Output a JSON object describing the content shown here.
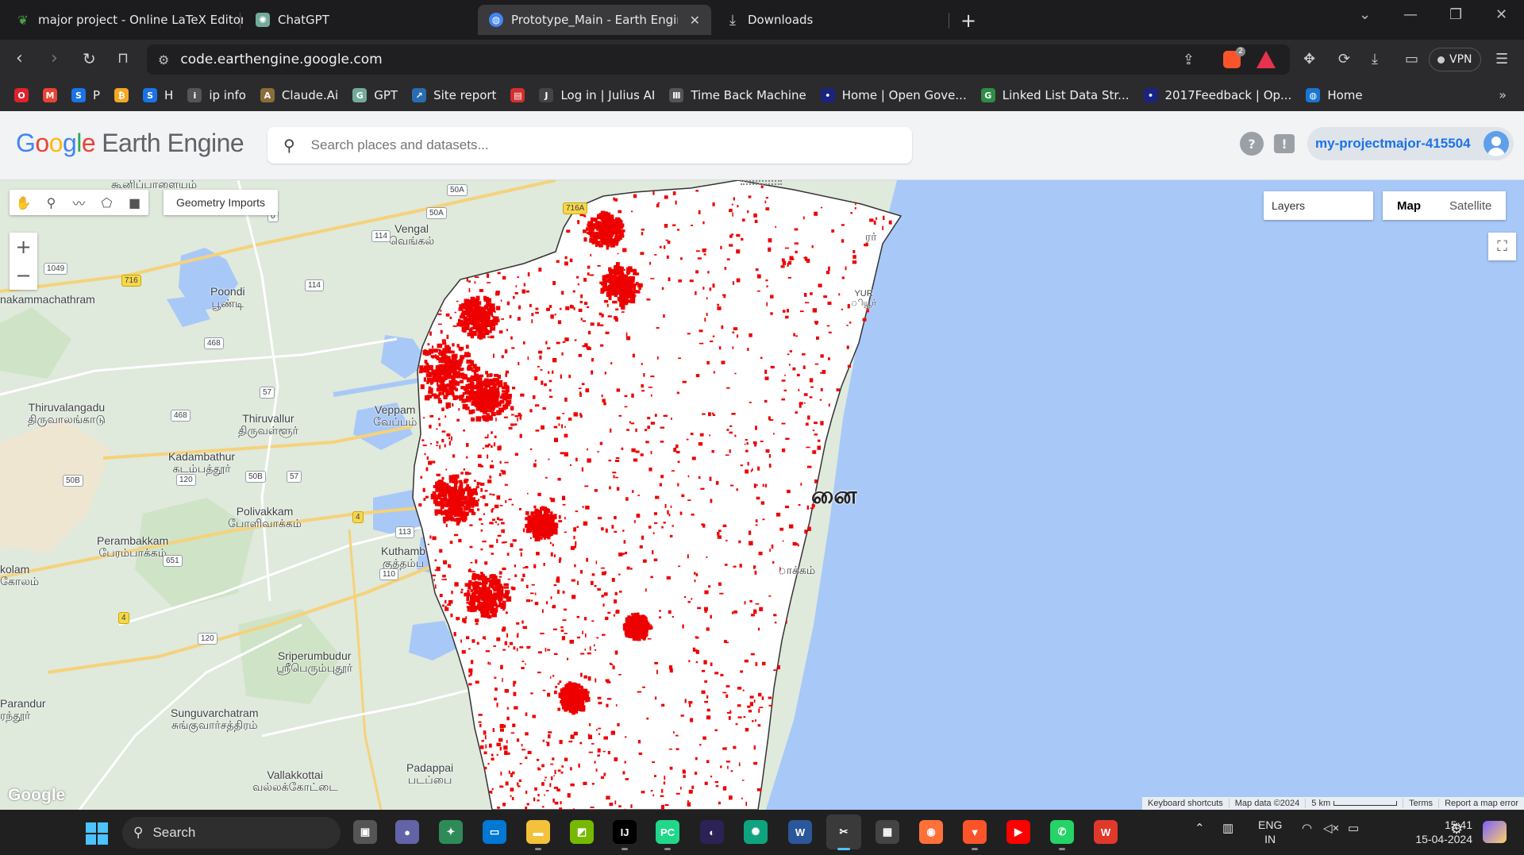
{
  "browser": {
    "tabs": [
      {
        "title": "major project - Online LaTeX Editor O",
        "icon": "overleaf-icon",
        "color": "#47a141"
      },
      {
        "title": "ChatGPT",
        "icon": "chatgpt-icon",
        "color": "#74aa9c"
      },
      {
        "title": "Prototype_Main - Earth Engine C",
        "icon": "earth-engine-icon",
        "color": "#4285f4",
        "active": true
      },
      {
        "title": "Downloads",
        "icon": "download-icon",
        "color": "#888888"
      }
    ],
    "new_tab_label": "+",
    "url": "code.earthengine.google.com",
    "vpn_label": "VPN",
    "brave_badge": "2"
  },
  "bookmarks": [
    {
      "label": "",
      "icon": "opera-icon",
      "color": "#e0212b",
      "glyph": "O"
    },
    {
      "label": "",
      "icon": "gmail-icon",
      "color": "#ea4335",
      "glyph": "M"
    },
    {
      "label": "P",
      "icon": "s-icon",
      "color": "#1a73e8",
      "glyph": "S"
    },
    {
      "label": "",
      "icon": "bolt-icon",
      "color": "#f5a623",
      "glyph": "₿"
    },
    {
      "label": "H",
      "icon": "s-icon",
      "color": "#1a73e8",
      "glyph": "S"
    },
    {
      "label": "ip info",
      "icon": "ipinfo-icon",
      "color": "#555555",
      "glyph": "i"
    },
    {
      "label": "Claude.Ai",
      "icon": "claude-icon",
      "color": "#8a6d3b",
      "glyph": "A"
    },
    {
      "label": "GPT",
      "icon": "chatgpt-icon",
      "color": "#74aa9c",
      "glyph": "G"
    },
    {
      "label": "Site report",
      "icon": "site-report-icon",
      "color": "#2b6cb0",
      "glyph": "↗"
    },
    {
      "label": "",
      "icon": "calendar-icon",
      "color": "#d32f2f",
      "glyph": "▤"
    },
    {
      "label": "Log in | Julius AI",
      "icon": "julius-icon",
      "color": "#444444",
      "glyph": "J"
    },
    {
      "label": "Time Back Machine",
      "icon": "archive-icon",
      "color": "#555555",
      "glyph": "Ⅲ"
    },
    {
      "label": "Home | Open Gove...",
      "icon": "ogd-icon",
      "color": "#1a237e",
      "glyph": "•"
    },
    {
      "label": "Linked List Data Str...",
      "icon": "gfg-icon",
      "color": "#2f8d46",
      "glyph": "G"
    },
    {
      "label": "2017Feedback | Op...",
      "icon": "ogd-icon",
      "color": "#1a237e",
      "glyph": "•"
    },
    {
      "label": "Home",
      "icon": "globe-icon",
      "color": "#1976d2",
      "glyph": "◍"
    }
  ],
  "ee": {
    "logo_google": [
      "G",
      "o",
      "o",
      "g",
      "l",
      "e"
    ],
    "logo_product": "Earth Engine",
    "search_placeholder": "Search places and datasets...",
    "help_label": "?",
    "feedback_label": "!",
    "project": "my-projectmajor-415504"
  },
  "map": {
    "geometry_imports_label": "Geometry Imports",
    "zoom_in": "+",
    "zoom_out": "−",
    "layers_label": "Layers",
    "map_type_options": [
      "Map",
      "Satellite"
    ],
    "selected_map_type": "Map",
    "google_logo": "Google",
    "attribution": {
      "keyboard": "Keyboard shortcuts",
      "data": "Map data ©2024",
      "scale": "5 km",
      "terms": "Terms",
      "report": "Report a map error"
    },
    "colors": {
      "land": "#dfe9dc",
      "water": "#a8c8f8",
      "overlay": "#ee0000",
      "roads": "#f5d27a"
    },
    "places": [
      {
        "text": "கூனிப்பாளையம்"
      },
      {
        "text": "Vengal\nவெங்கல்"
      },
      {
        "text": "Poondi\nபூண்டி"
      },
      {
        "text": "nakammachathram"
      },
      {
        "text": "Thiruvalangadu\nதிருவாலங்காடு"
      },
      {
        "text": "Thiruvallur\nதிருவள்ளூர்"
      },
      {
        "text": "Veppam\nவேப்பம்"
      },
      {
        "text": "Kadambathur\nகடம்பத்தூர்"
      },
      {
        "text": "Polivakkam\nபோளிவாக்கம்"
      },
      {
        "text": "Perambakkam\nபேரம்பாக்கம்"
      },
      {
        "text": "kolam\nகோலம்"
      },
      {
        "text": "Kuthamb\nகுத்தம்ப"
      },
      {
        "text": "Sriperumbudur\nஸ்ரீபெரும்புதூர்"
      },
      {
        "text": "Parandur\nரந்தூர்"
      },
      {
        "text": "Sunguvarchatram\nசுங்குவார்சத்திரம்"
      },
      {
        "text": "Vallakkottai\nவல்லக்கோட்டை"
      },
      {
        "text": "Padappai\nபடப்பை"
      },
      {
        "text": "னை"
      },
      {
        "text": "ாக்கம்"
      },
      {
        "text": "ரர்"
      },
      {
        "text": "YUR\nியூர்"
      }
    ],
    "shields": [
      "50A",
      "50A",
      "716A",
      "114",
      "114",
      "1049",
      "716",
      "468",
      "468",
      "57",
      "120",
      "50B",
      "50B",
      "57",
      "4",
      "113",
      "651",
      "110",
      "4",
      "120",
      "0"
    ]
  },
  "taskbar": {
    "search_label": "Search",
    "apps": [
      {
        "name": "task-view",
        "color": "#555555",
        "glyph": "▣"
      },
      {
        "name": "zoom",
        "color": "#6264a7",
        "glyph": "●"
      },
      {
        "name": "widgets",
        "color": "#2e8b57",
        "glyph": "✦"
      },
      {
        "name": "remote-desktop",
        "color": "#0078d4",
        "glyph": "▭"
      },
      {
        "name": "file-explorer",
        "color": "#f3c13a",
        "glyph": "▬"
      },
      {
        "name": "nvidia",
        "color": "#76b900",
        "glyph": "◩"
      },
      {
        "name": "intellij",
        "color": "#000000",
        "glyph": "IJ"
      },
      {
        "name": "pycharm",
        "color": "#21d789",
        "glyph": "PC"
      },
      {
        "name": "eclipse",
        "color": "#2c2255",
        "glyph": "◐"
      },
      {
        "name": "chatgpt",
        "color": "#10a37f",
        "glyph": "✺"
      },
      {
        "name": "word",
        "color": "#2b579a",
        "glyph": "W"
      },
      {
        "name": "snipping-tool",
        "color": "#3a3a3a",
        "glyph": "✂"
      },
      {
        "name": "calculator",
        "color": "#444444",
        "glyph": "▦"
      },
      {
        "name": "firefox",
        "color": "#ff7139",
        "glyph": "◉"
      },
      {
        "name": "brave",
        "color": "#fb542b",
        "glyph": "▼"
      },
      {
        "name": "youtube",
        "color": "#ff0000",
        "glyph": "▶"
      },
      {
        "name": "whatsapp",
        "color": "#25d366",
        "glyph": "✆"
      },
      {
        "name": "wps-office",
        "color": "#e0392b",
        "glyph": "W"
      }
    ],
    "lang_top": "ENG",
    "lang_bottom": "IN",
    "time": "15:41",
    "date": "15-04-2024"
  }
}
